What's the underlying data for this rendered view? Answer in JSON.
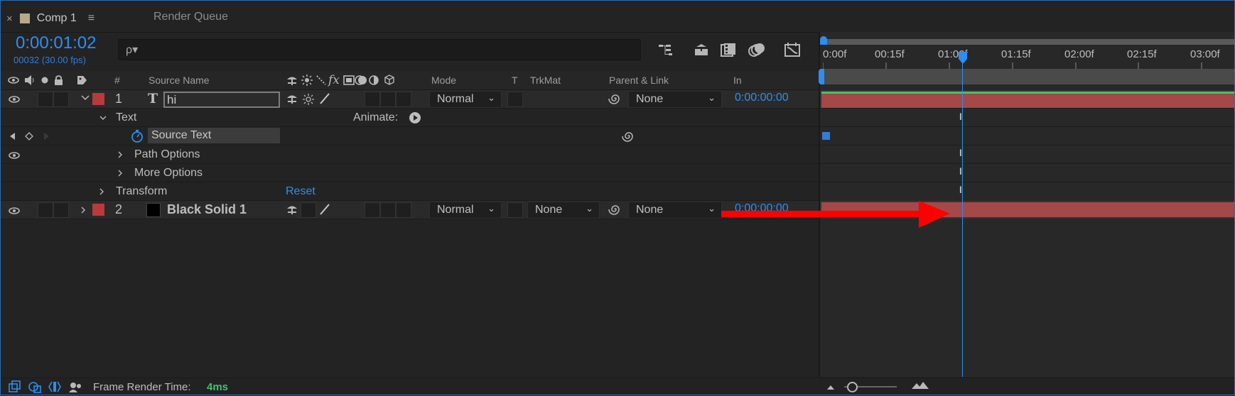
{
  "tabs": {
    "close": "×",
    "active_label": "Comp 1",
    "menu": "≡",
    "inactive_label": "Render Queue"
  },
  "comp": {
    "timecode": "0:00:01:02",
    "frames": "00032 (30.00 fps)"
  },
  "search": {
    "icon": "ρ▾",
    "value": "",
    "placeholder": ""
  },
  "columns": {
    "number": "#",
    "source_name": "Source Name",
    "mode": "Mode",
    "t": "T",
    "trkmat": "TrkMat",
    "parent": "Parent & Link",
    "in": "In"
  },
  "ruler": {
    "ticks": [
      "0:00f",
      "00:15f",
      "01:00f",
      "01:15f",
      "02:00f",
      "02:15f",
      "03:00f"
    ]
  },
  "layers": [
    {
      "number": "1",
      "type_glyph": "T",
      "name": "hi",
      "mode": "Normal",
      "trkmat": "",
      "parent": "None",
      "in": "0:00:00:00",
      "color": "#b83a3a"
    },
    {
      "number": "2",
      "name": "Black Solid 1",
      "mode": "Normal",
      "trkmat": "None",
      "parent": "None",
      "in": "0:00:00:00",
      "color": "#b83a3a"
    }
  ],
  "props": {
    "text_group": "Text",
    "animate": "Animate:",
    "source_text": "Source Text",
    "path_options": "Path Options",
    "more_options": "More Options",
    "transform": "Transform",
    "reset": "Reset"
  },
  "status": {
    "label": "Frame Render Time:",
    "value": "4ms"
  },
  "colors": {
    "accent": "#2e8eef",
    "layer_bar": "#a44848",
    "arrow": "#ff0000",
    "frame_time": "#3fc46a"
  }
}
